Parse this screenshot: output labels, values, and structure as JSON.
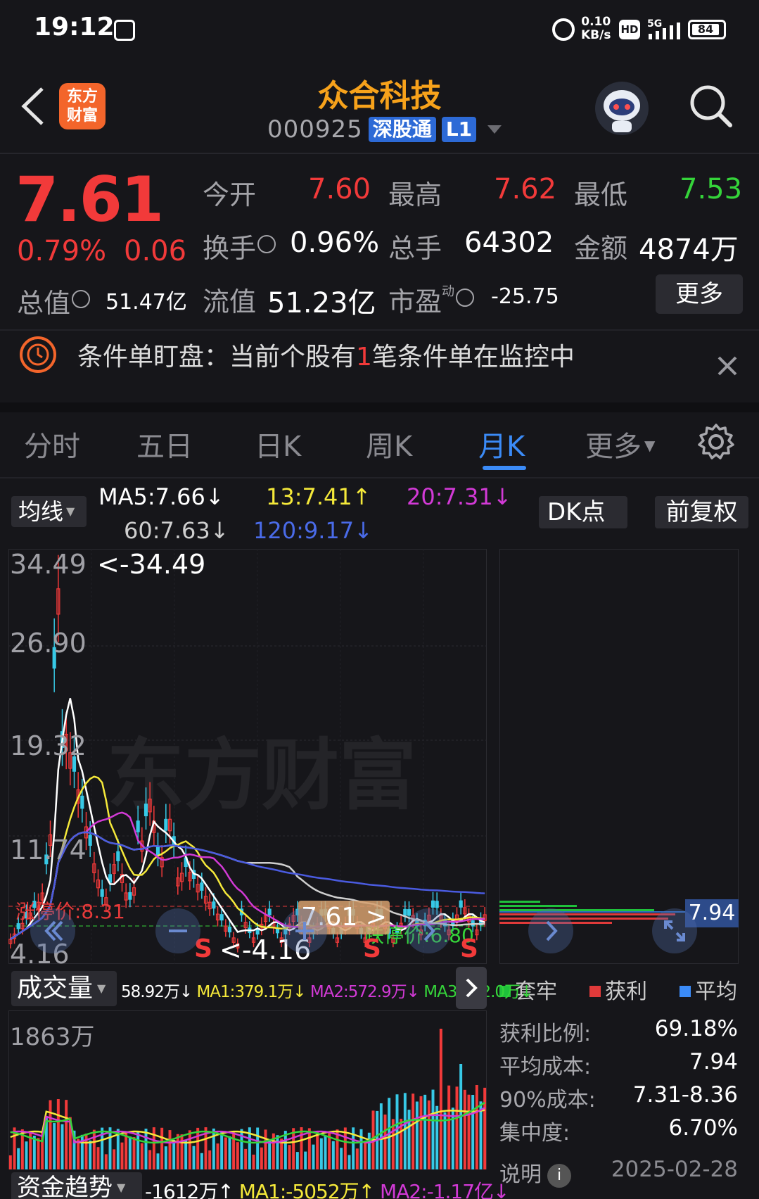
{
  "status": {
    "time": "19:12",
    "net_speed_top": "0.10",
    "net_speed_bottom": "KB/s",
    "hd": "HD",
    "network": "5G",
    "battery": "84"
  },
  "header": {
    "logo_line1": "东方",
    "logo_line2": "财富",
    "stock_name": "众合科技",
    "stock_code": "000925",
    "connect_tag": "深股通",
    "level_tag": "L1"
  },
  "quote": {
    "price": "7.61",
    "pct_change": "0.79%",
    "abs_change": "0.06",
    "open_label": "今开",
    "open_value": "7.60",
    "high_label": "最高",
    "high_value": "7.62",
    "low_label": "最低",
    "low_value": "7.53",
    "turnover_label": "换手",
    "turnover_value": "0.96%",
    "volume_label": "总手",
    "volume_value": "64302",
    "amount_label": "金额",
    "amount_value": "4874万",
    "total_value_label": "总值",
    "total_value": "51.47亿",
    "float_value_label": "流值",
    "float_value": "51.23亿",
    "pe_label": "市盈",
    "pe_superscript": "动",
    "pe_value": "-25.75",
    "more_label": "更多"
  },
  "alert": {
    "text_before": "条件单盯盘：当前个股有",
    "count": "1",
    "text_after": "笔条件单在监控中"
  },
  "tabs": [
    {
      "label": "分时"
    },
    {
      "label": "五日"
    },
    {
      "label": "日K"
    },
    {
      "label": "周K"
    },
    {
      "label": "月K"
    },
    {
      "label": "更多"
    }
  ],
  "active_tab": "月K",
  "ma_legend": {
    "type_label": "均线",
    "ma5": "MA5:7.66↓",
    "ma13": "13:7.41↑",
    "ma20": "20:7.31↓",
    "ma60": "60:7.63↓",
    "ma120": "120:9.17↓",
    "dk_label": "DK点",
    "fq_label": "前复权"
  },
  "kchart": {
    "y_labels": [
      "34.49",
      "26.90",
      "19.32",
      "11.74",
      "4.16"
    ],
    "max_marker": "<-34.49",
    "min_marker": "<-4.16",
    "limit_up_label": "涨停价:8.31",
    "limit_down_label": "跌停价:6.80",
    "current_price_tag": "7.61 >",
    "watermark": "东方财富",
    "sell_marker": "S",
    "colors": {
      "up": "#f23a3a",
      "down": "#37c9e6",
      "ma5": "#ffffff",
      "ma13": "#f5e93a",
      "ma20": "#d23ad6",
      "ma60": "#cfcfcf",
      "ma120": "#4a5be0"
    }
  },
  "chip": {
    "avg_tag": "7.94",
    "legend": [
      "套牢",
      "获利",
      "平均"
    ],
    "legend_colors": [
      "#1fc13b",
      "#e03a3a",
      "#3b8bf7"
    ],
    "rows": [
      {
        "label": "获利比例:",
        "value": "69.18%"
      },
      {
        "label": "平均成本:",
        "value": "7.94"
      },
      {
        "label": "90%成本:",
        "value": "7.31-8.36"
      },
      {
        "label": "集中度:",
        "value": "6.70%"
      }
    ],
    "note_label": "说明",
    "date": "2025-02-28"
  },
  "volume": {
    "type_label": "成交量",
    "current": "58.92万↓",
    "ma1": "MA1:379.1万↓",
    "ma2": "MA2:572.9万↓",
    "ma3": "MA3:472.0万↓",
    "max_label": "1863万"
  },
  "fund": {
    "type_label": "资金趋势",
    "current": "-1612万↑",
    "ma1": "MA1:-5052万↑",
    "ma2": "MA2:-1.17亿↓"
  }
}
